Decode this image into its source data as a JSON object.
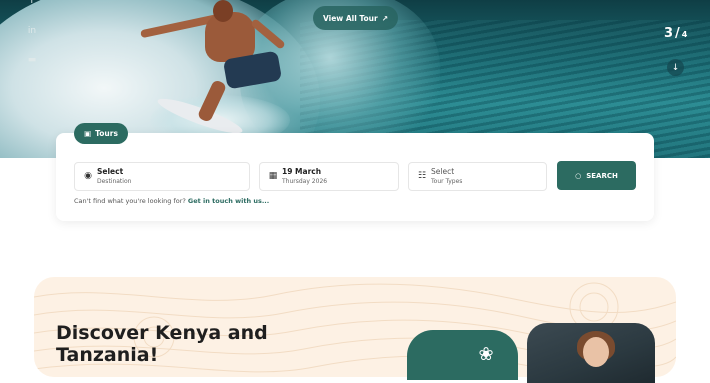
{
  "hero": {
    "view_all_label": "View All Tour",
    "view_all_icon": "arrow-up-right-icon",
    "slide_current": "3",
    "slide_separator": "/",
    "slide_total": "4",
    "side_icons": [
      "facebook-icon",
      "linkedin-icon",
      "youtube-icon"
    ],
    "scroll_icon": "arrow-down-icon"
  },
  "search": {
    "tab_label": "Tours",
    "destination": {
      "label": "Select",
      "sub": "Destination"
    },
    "date": {
      "label": "19 March",
      "sub": "Thursday 2026"
    },
    "tour_type": {
      "label": "Select",
      "sub": "Tour Types"
    },
    "button_label": "SEARCH",
    "help_text": "Can't find what you're looking for?",
    "help_link": "Get in touch with us..."
  },
  "promo": {
    "title_line1": "Discover Kenya and",
    "title_line2": "Tanzania!"
  },
  "colors": {
    "brand_green": "#2c6b61",
    "promo_bg": "#fdf1e4"
  }
}
